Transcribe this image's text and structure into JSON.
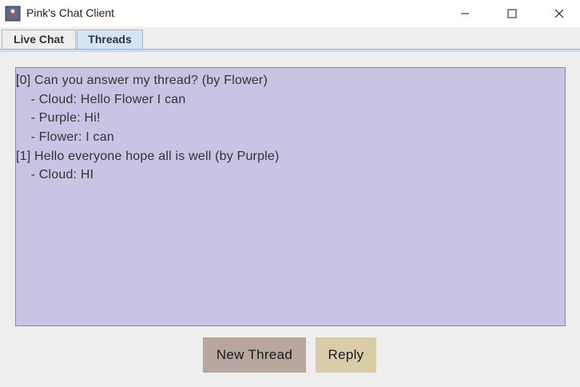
{
  "window": {
    "title": "Pink's Chat Client",
    "app_icon": "java-app-icon"
  },
  "tabs": [
    {
      "label": "Live Chat",
      "selected": false
    },
    {
      "label": "Threads",
      "selected": true
    }
  ],
  "threads": {
    "background_color": "#cbc3e4",
    "lines": [
      "[0] Can you answer my thread? (by Flower)",
      "    - Cloud: Hello Flower I can",
      "    - Purple: Hi!",
      "    - Flower: I can",
      "[1] Hello everyone hope all is well (by Purple)",
      "    - Cloud: HI"
    ]
  },
  "buttons": {
    "new_thread": {
      "label": "New Thread",
      "color": "#b8a79f"
    },
    "reply": {
      "label": "Reply",
      "color": "#d9cda8"
    }
  }
}
